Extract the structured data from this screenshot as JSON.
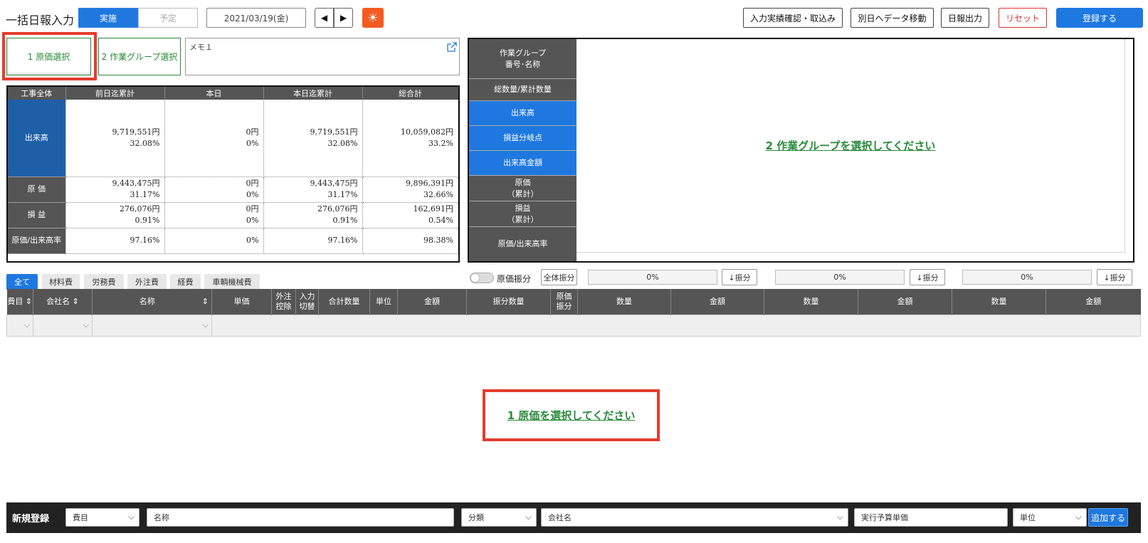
{
  "header": {
    "title": "一括日報入力",
    "mode_actual": "実施",
    "mode_plan": "予定",
    "date": "2021/03/19(金)",
    "prev_glyph": "◀",
    "next_glyph": "▶",
    "weather_icon": "sun-icon",
    "weather_glyph": "☀",
    "btn_confirm": "入力実績確認・取込み",
    "btn_move": "別日へデータ移動",
    "btn_report": "日報出力",
    "btn_reset": "リセット",
    "btn_register": "登録する"
  },
  "steps": {
    "step1": "1 原価選択",
    "step2": "2 作業グループ選択"
  },
  "memo": {
    "value": "メモ１"
  },
  "summary": {
    "headers": [
      "工事全体",
      "前日迄累計",
      "本日",
      "本日迄累計",
      "総合計"
    ],
    "rows": [
      {
        "label": "出来高",
        "cells": [
          [
            "9,719,551円",
            "32.08%"
          ],
          [
            "0円",
            "0%"
          ],
          [
            "9,719,551円",
            "32.08%"
          ],
          [
            "10,059,082円",
            "33.2%"
          ]
        ]
      },
      {
        "label": "原 価",
        "cells": [
          [
            "9,443,475円",
            "31.17%"
          ],
          [
            "0円",
            "0%"
          ],
          [
            "9,443,475円",
            "31.17%"
          ],
          [
            "9,896,391円",
            "32.66%"
          ]
        ]
      },
      {
        "label": "損 益",
        "cells": [
          [
            "276,076円",
            "0.91%"
          ],
          [
            "0円",
            "0%"
          ],
          [
            "276,076円",
            "0.91%"
          ],
          [
            "162,691円",
            "0.54%"
          ]
        ]
      },
      {
        "label": "原価/出来高率",
        "cells": [
          [
            "97.16%"
          ],
          [
            "0%"
          ],
          [
            "97.16%"
          ],
          [
            "98.38%"
          ]
        ]
      }
    ]
  },
  "workgroup": {
    "rows": [
      "作業グループ\n番号･名称",
      "総数量/累計数量",
      "出来高",
      "損益分岐点",
      "出来高金額",
      "原価\n（累計）",
      "損益\n（累計）",
      "原価/出来高率"
    ],
    "empty_message": "2 作業グループを選択してください"
  },
  "categories": [
    "全て",
    "材料費",
    "労務費",
    "外注費",
    "経費",
    "車輌機械費"
  ],
  "allocation": {
    "toggle_label": "原価振分",
    "all_alloc_btn": "全体振分",
    "pct": [
      "0%",
      "0%",
      "0%"
    ],
    "alloc_btn": "↓振分"
  },
  "main_table": {
    "headers": [
      "費目",
      "会社名",
      "名称",
      "単価",
      "外注\n控除",
      "入力\n切替",
      "合計数量",
      "単位",
      "金額",
      "振分数量",
      "原価\n振分",
      "数量",
      "金額",
      "数量",
      "金額",
      "数量",
      "金額"
    ],
    "empty_message": "1 原価を選択してください"
  },
  "bottom": {
    "title": "新規登録",
    "cost_item": "費目",
    "name": "名称",
    "classification": "分類",
    "company": "会社名",
    "unit_price": "実行予算単価",
    "unit": "単位",
    "add_btn": "追加する"
  }
}
